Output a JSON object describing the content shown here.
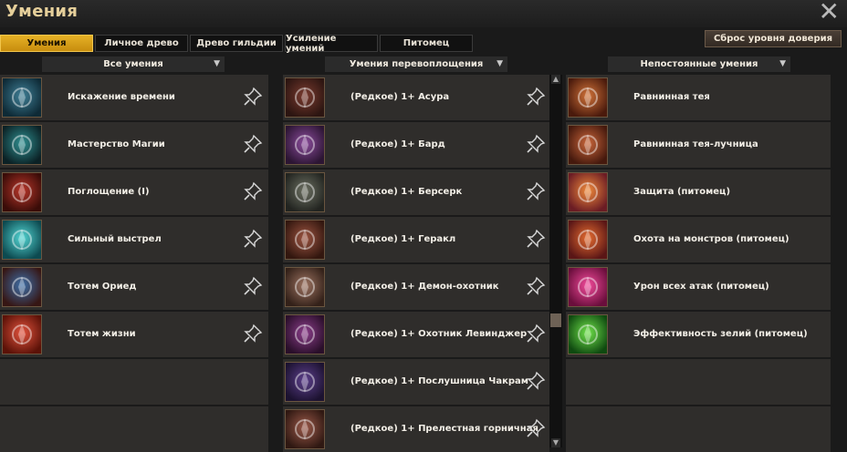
{
  "window": {
    "title": "Умения"
  },
  "tabs": [
    {
      "label": "Умения",
      "active": true
    },
    {
      "label": "Личное древо",
      "active": false
    },
    {
      "label": "Древо гильдии",
      "active": false
    },
    {
      "label": "Усиление умений",
      "active": false
    },
    {
      "label": "Питомец",
      "active": false
    }
  ],
  "reset_button": "Сброс уровня доверия",
  "columns": [
    {
      "header": "Все умения",
      "items": [
        {
          "label": "Искажение времени",
          "icon": "time-distortion-icon",
          "colors": [
            "#3f7f96",
            "#0e2a36"
          ]
        },
        {
          "label": "Мастерство Магии",
          "icon": "magic-mastery-icon",
          "colors": [
            "#2f8f90",
            "#0b2125"
          ]
        },
        {
          "label": "Поглощение (I)",
          "icon": "absorption-shield-icon",
          "colors": [
            "#b8362a",
            "#3a0c08"
          ]
        },
        {
          "label": "Сильный выстрел",
          "icon": "strong-shot-icon",
          "colors": [
            "#52d6d4",
            "#0d4a50"
          ]
        },
        {
          "label": "Тотем Ориед",
          "icon": "oried-totem-icon",
          "colors": [
            "#3d6ea7",
            "#361614"
          ]
        },
        {
          "label": "Тотем жизни",
          "icon": "life-totem-icon",
          "colors": [
            "#e2523c",
            "#5c1208"
          ]
        }
      ]
    },
    {
      "header": "Умения перевоплощения",
      "items": [
        {
          "label": "(Редкое) 1+ Асура",
          "icon": "asura-card-icon",
          "colors": [
            "#7a3b2f",
            "#2c1511"
          ]
        },
        {
          "label": "(Редкое) 1+ Бард",
          "icon": "bard-card-icon",
          "colors": [
            "#8b4c9c",
            "#2c1533"
          ]
        },
        {
          "label": "(Редкое) 1+ Берсерк",
          "icon": "berserker-card-icon",
          "colors": [
            "#6b6f61",
            "#222420"
          ]
        },
        {
          "label": "(Редкое) 1+ Геракл",
          "icon": "heracles-card-icon",
          "colors": [
            "#9b5340",
            "#33170f"
          ]
        },
        {
          "label": "(Редкое) 1+ Демон-охотник",
          "icon": "demon-hunter-card-icon",
          "colors": [
            "#9c7260",
            "#332119"
          ]
        },
        {
          "label": "(Редкое) 1+ Охотник Левинджер",
          "icon": "levinger-hunter-card-icon",
          "colors": [
            "#8b3d8a",
            "#2a0f2a"
          ]
        },
        {
          "label": "(Редкое) 1+ Послушница Чакрам",
          "icon": "chakram-novice-card-icon",
          "colors": [
            "#5c3f8b",
            "#1c1230"
          ]
        },
        {
          "label": "(Редкое) 1+ Прелестная горничная",
          "icon": "charming-maid-card-icon",
          "colors": [
            "#9a5848",
            "#2f1812"
          ]
        }
      ]
    },
    {
      "header": "Непостоянные умения",
      "items": [
        {
          "label": "Равнинная тея",
          "icon": "plains-teya-icon",
          "colors": [
            "#d17238",
            "#4a1a0c"
          ]
        },
        {
          "label": "Равнинная тея-лучница",
          "icon": "plains-teya-archer-icon",
          "colors": [
            "#c9653a",
            "#45190d"
          ]
        },
        {
          "label": "Защита (питомец)",
          "icon": "pet-defense-icon",
          "colors": [
            "#f08a3a",
            "#6b1c24"
          ]
        },
        {
          "label": "Охота на монстров (питомец)",
          "icon": "pet-monster-hunt-icon",
          "colors": [
            "#e56b2f",
            "#5a1616"
          ]
        },
        {
          "label": "Урон всех атак (питомец)",
          "icon": "pet-attack-damage-icon",
          "colors": [
            "#f24a9a",
            "#6a0e3c"
          ]
        },
        {
          "label": "Эффективность зелий (питомец)",
          "icon": "pet-potion-efficiency-icon",
          "colors": [
            "#6fe24a",
            "#0f4a10"
          ]
        }
      ]
    }
  ]
}
